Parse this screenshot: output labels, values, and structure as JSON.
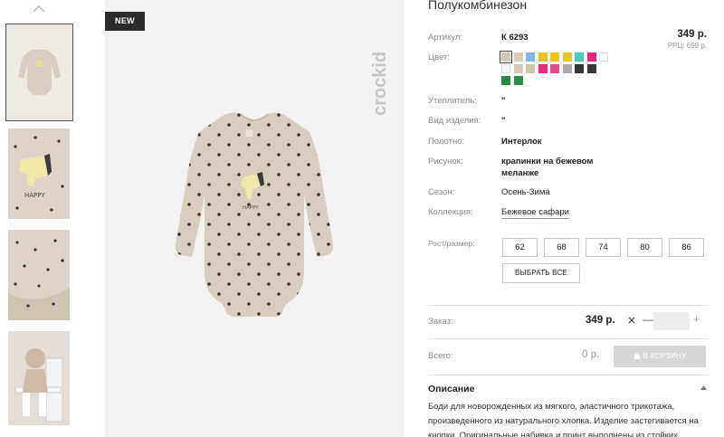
{
  "badge": "NEW",
  "brand": "crockid",
  "product": {
    "title": "Полукомбинезон",
    "price": "349 р.",
    "rrp": "РРЦ: 699 р."
  },
  "attributes": {
    "article_label": "Артикул:",
    "article_value": "К 6293",
    "color_label": "Цвет:",
    "insulation_label": "Утеплитель:",
    "insulation_value": "\"",
    "kind_label": "Вид изделия:",
    "kind_value": "\"",
    "fabric_label": "Полотно:",
    "fabric_value": "Интерлок",
    "pattern_label": "Рисунок:",
    "pattern_value_1": "крапинки на бежевом",
    "pattern_value_2": "меланже",
    "season_label": "Сезон:",
    "season_value": "Осень-Зима",
    "collection_label": "Коллекция:",
    "collection_value": "Бежевое сафари"
  },
  "swatch_colors": [
    "#d4c7b3",
    "#d9cbb4",
    "#7fb6e6",
    "#e8c22a",
    "#f0c419",
    "#e6c52c",
    "#4ccab8",
    "#e8277a",
    "#ffffff",
    "#f7f7f7",
    "#d8c9b0",
    "#d2c4a8",
    "#e8277a",
    "#e64a8c",
    "#a9a9a9",
    "#333333",
    "#3a3a3a",
    "#2a8a44",
    "#2f8f4d"
  ],
  "sizes": {
    "label": "Рост/размер:",
    "options": [
      "62",
      "68",
      "74",
      "80",
      "86"
    ],
    "select_all": "ВЫБРАТЬ ВСЕ"
  },
  "order": {
    "label": "Заказ:",
    "price": "349 р.",
    "minus": "—",
    "plus": "+",
    "quantity": ""
  },
  "total": {
    "label": "Всего:",
    "value": "0 р.",
    "cart_button": "В КОРЗИНУ"
  },
  "description": {
    "title": "Описание",
    "text": "Боди для новорожденных из мягкого, эластичного трикотажа, произведенного из натурального хлопка. Изделие застегивается на кнопки. Оригинальные набивка и принт выполнены из стойких,"
  },
  "colors": {
    "badge_bg": "#2b2b2b",
    "image_bg": "#f3f1f2",
    "garment": "#d8cdbf",
    "button_disabled": "#d6d6d6"
  }
}
